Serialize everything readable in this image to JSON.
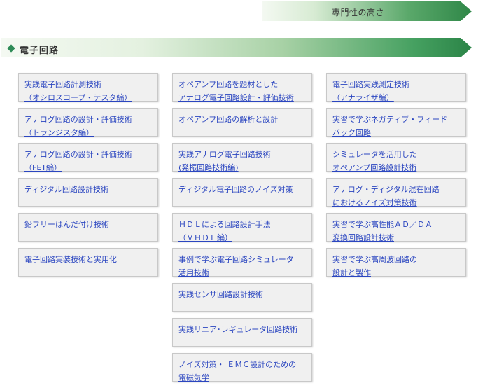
{
  "header": {
    "specialty_label": "専門性の高さ"
  },
  "section": {
    "title": "電子回路"
  },
  "columns": [
    [
      "実践電子回路計測技術\n（オシロスコープ・テスタ編）",
      "アナログ回路の設計・評価技術\n（トランジスタ編）",
      "アナログ回路の設計・評価技術\n（FET編）",
      "ディジタル回路設計技術",
      "鉛フリーはんだ付け技術",
      "電子回路実装技術と実用化"
    ],
    [
      "オペアンプ回路を題材とした\nアナログ電子回路設計・評価技術",
      "オペアンプ回路の解析と設計",
      "実践アナログ電子回路技術\n(発振回路技術編)",
      "ディジタル電子回路のノイズ対策",
      "ＨＤＬによる回路設計手法\n（ＶＨＤＬ編）",
      "事例で学ぶ電子回路シミュレータ\n活用技術",
      "実践センサ回路設計技術",
      "実践リニア･レギュレータ回路技術",
      "ノイズ対策・ ＥＭＣ設計のための\n電磁気学"
    ],
    [
      "電子回路実践測定技術\n（アナライザ編）",
      "実習で学ぶネガティブ・フィード\nバック回路",
      "シミュレータを活用した\nオペアンプ回路設計技術",
      "アナログ・ディジタル混在回路\nにおけるノイズ対策技術",
      "実習で学ぶ高性能ＡＤ／ＤＡ\n変換回路設計技術",
      "実習で学ぶ高周波回路の\n設計と製作"
    ]
  ]
}
